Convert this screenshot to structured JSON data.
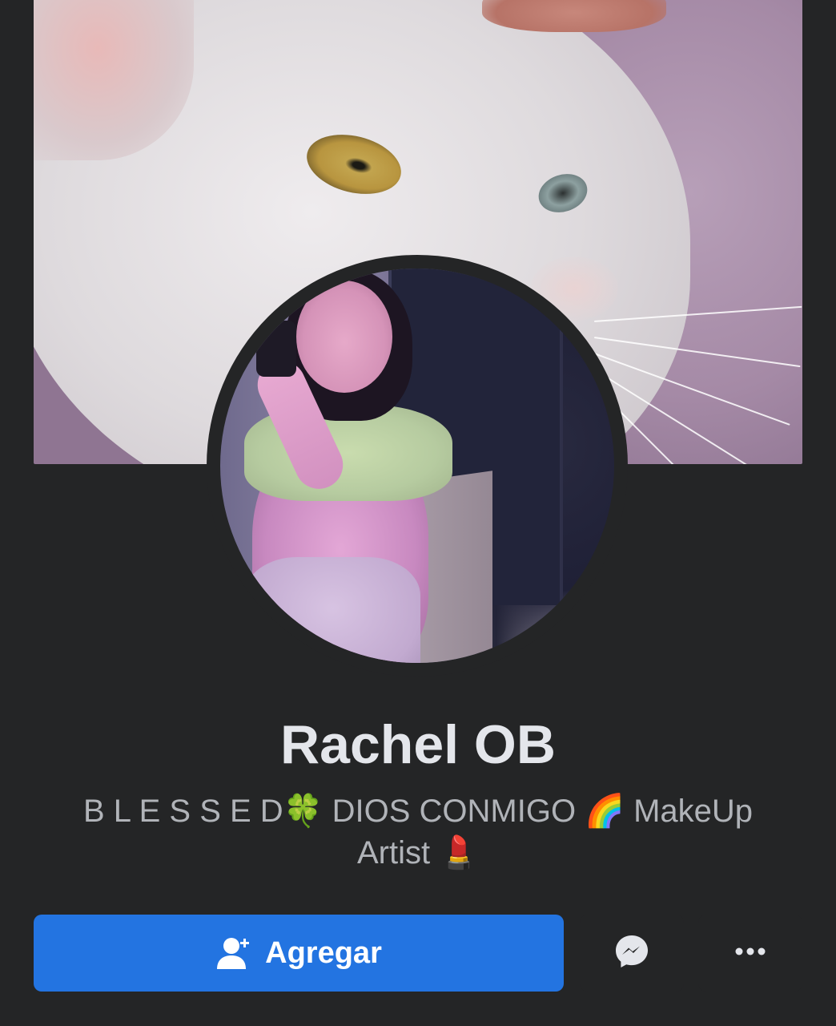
{
  "profile": {
    "name": "Rachel OB",
    "bio_line1": "B L E S S E D🍀 DIOS CONMIGO 🌈 MakeUp",
    "bio_line2": "Artist 💄"
  },
  "actions": {
    "add_label": "Agregar",
    "add_icon": "add-friend-icon",
    "message_icon": "messenger-icon",
    "more_icon": "more-options-icon"
  },
  "colors": {
    "background": "#242526",
    "primary_button": "#2374e1",
    "name_text": "#e4e6eb",
    "bio_text": "#b0b3b8"
  }
}
